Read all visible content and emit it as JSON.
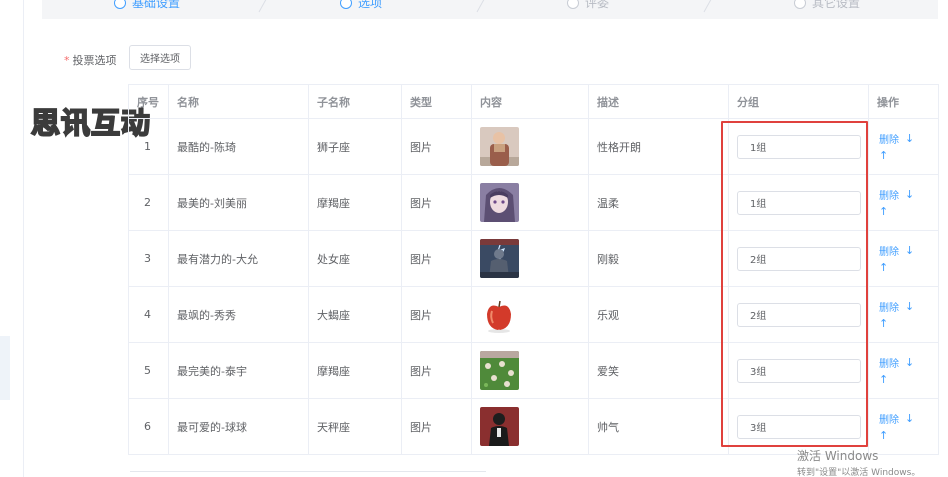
{
  "steps": [
    {
      "label": "基础设置",
      "state": "done"
    },
    {
      "label": "选项",
      "state": "done"
    },
    {
      "label": "评委",
      "state": "todo"
    },
    {
      "label": "其它设置",
      "state": "todo"
    }
  ],
  "form": {
    "required_mark": "*",
    "vote_options_label": "投票选项",
    "select_button": "选择选项"
  },
  "watermark": "思讯互动",
  "table": {
    "headers": [
      "序号",
      "名称",
      "子名称",
      "类型",
      "内容",
      "描述",
      "分组",
      "操作"
    ],
    "rows": [
      {
        "idx": "1",
        "name": "最酷的-陈琦",
        "sub": "狮子座",
        "type": "图片",
        "desc": "性格开朗",
        "group": "1组",
        "thumb": "person-brown"
      },
      {
        "idx": "2",
        "name": "最美的-刘美丽",
        "sub": "摩羯座",
        "type": "图片",
        "desc": "温柔",
        "group": "1组",
        "thumb": "anime-girl"
      },
      {
        "idx": "3",
        "name": "最有潜力的-大允",
        "sub": "处女座",
        "type": "图片",
        "desc": "刚毅",
        "group": "2组",
        "thumb": "armored-figure"
      },
      {
        "idx": "4",
        "name": "最飒的-秀秀",
        "sub": "大蝎座",
        "type": "图片",
        "desc": "乐观",
        "group": "2组",
        "thumb": "apple"
      },
      {
        "idx": "5",
        "name": "最完美的-泰宇",
        "sub": "摩羯座",
        "type": "图片",
        "desc": "爱笑",
        "group": "3组",
        "thumb": "garden"
      },
      {
        "idx": "6",
        "name": "最可爱的-球球",
        "sub": "天秤座",
        "type": "图片",
        "desc": "帅气",
        "group": "3组",
        "thumb": "dark-figure"
      }
    ],
    "op_delete": "删除",
    "op_down": "↓",
    "op_up": "↑"
  },
  "windows_activation": {
    "line1": "激活 Windows",
    "line2": "转到\"设置\"以激活 Windows。"
  },
  "colors": {
    "accent": "#409eff",
    "highlight_box": "#e0413d",
    "required": "#f56c6c"
  }
}
